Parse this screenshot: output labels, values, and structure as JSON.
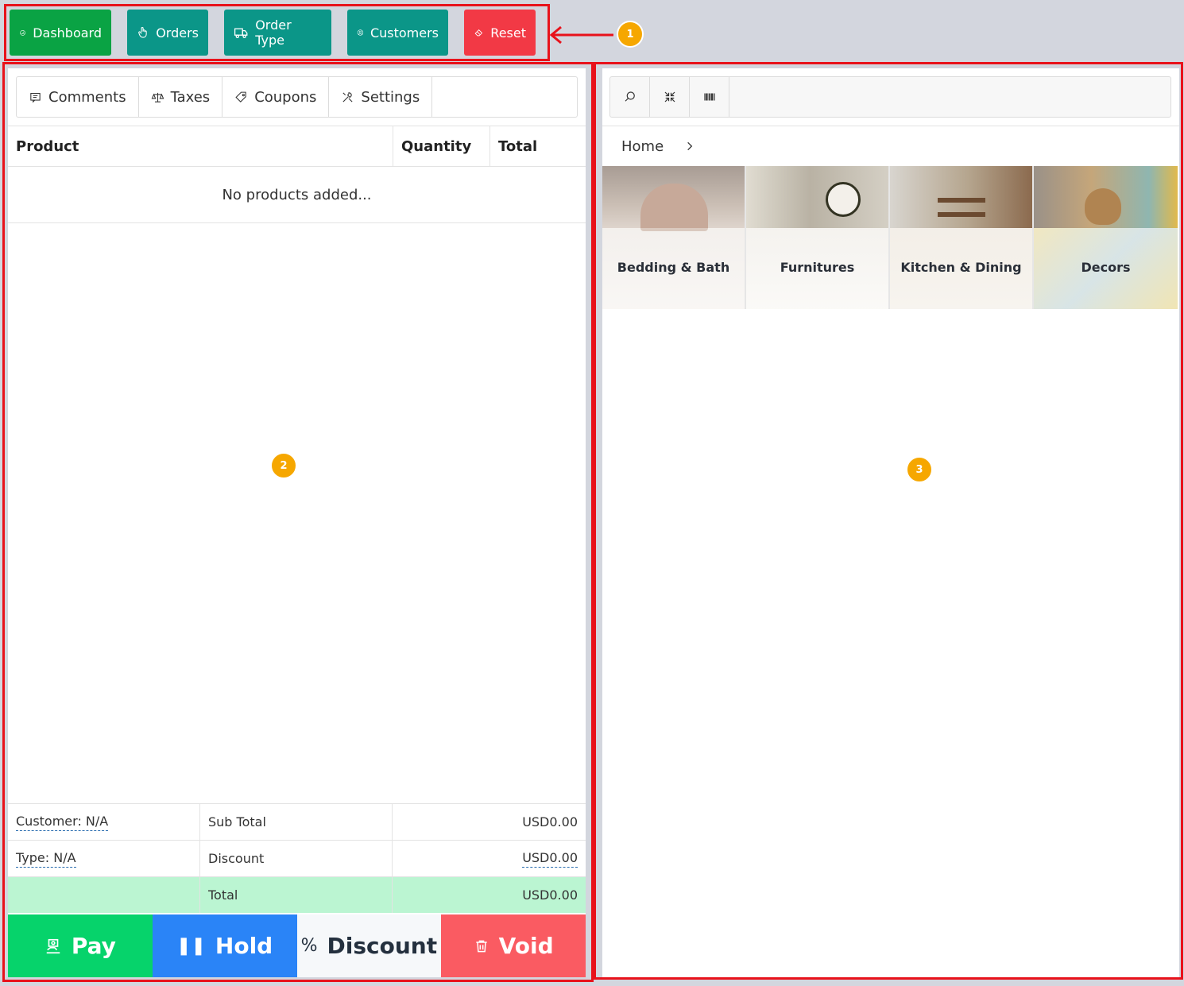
{
  "toolbar": {
    "buttons": [
      {
        "label": "Dashboard",
        "icon": "speedometer-icon",
        "color": "#0aa344"
      },
      {
        "label": "Orders",
        "icon": "hand-pointer-icon",
        "color": "#0b9688"
      },
      {
        "label": "Order Type",
        "icon": "truck-icon",
        "color": "#0b9688"
      },
      {
        "label": "Customers",
        "icon": "user-circle-icon",
        "color": "#0b9688"
      },
      {
        "label": "Reset",
        "icon": "eraser-icon",
        "color": "#f23945"
      }
    ]
  },
  "annotations": {
    "badge1": "1",
    "badge2": "2",
    "badge3": "3",
    "box_color": "#e8121b",
    "badge_color": "#f6a700"
  },
  "cart": {
    "tabs": [
      {
        "label": "Comments",
        "icon": "comment-icon"
      },
      {
        "label": "Taxes",
        "icon": "scale-icon"
      },
      {
        "label": "Coupons",
        "icon": "tag-icon"
      },
      {
        "label": "Settings",
        "icon": "tools-icon"
      }
    ],
    "columns": {
      "product": "Product",
      "quantity": "Quantity",
      "total": "Total"
    },
    "empty_message": "No products added...",
    "summary": {
      "customer": "Customer: N/A",
      "type": "Type: N/A",
      "subtotal_label": "Sub Total",
      "subtotal_value": "USD0.00",
      "discount_label": "Discount",
      "discount_value": "USD0.00",
      "total_label": "Total",
      "total_value": "USD0.00"
    },
    "actions": {
      "pay": "Pay",
      "hold": "Hold",
      "discount": "Discount",
      "void": "Void"
    }
  },
  "catalog": {
    "breadcrumb_home": "Home",
    "categories": [
      {
        "label": "Bedding & Bath"
      },
      {
        "label": "Furnitures"
      },
      {
        "label": "Kitchen & Dining"
      },
      {
        "label": "Decors"
      }
    ]
  }
}
